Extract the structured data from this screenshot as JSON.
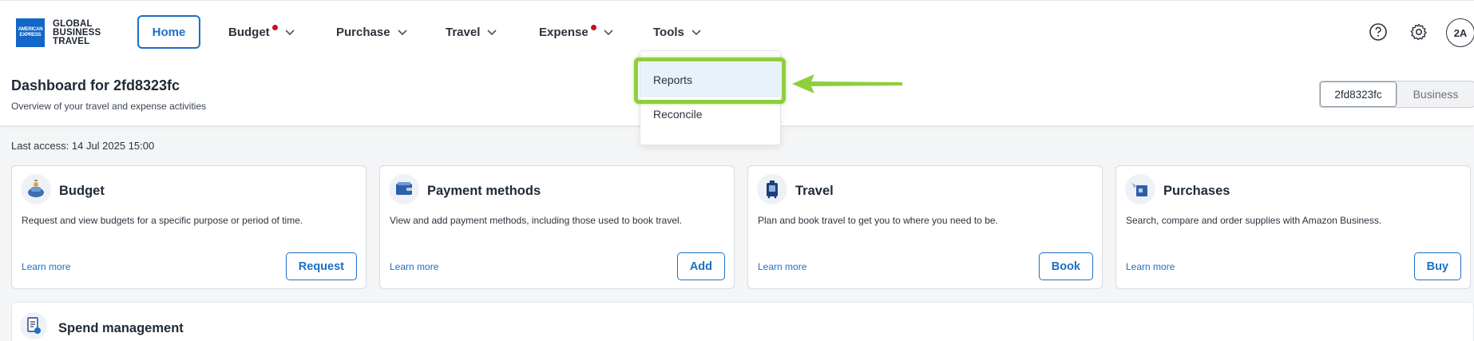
{
  "logo": {
    "box_text": "AMERICAN EXPRESS",
    "line1": "GLOBAL",
    "line2": "BUSINESS",
    "line3": "TRAVEL"
  },
  "nav": {
    "home": "Home",
    "budget": "Budget",
    "purchase": "Purchase",
    "travel": "Travel",
    "expense": "Expense",
    "tools": "Tools"
  },
  "user": {
    "initials": "2A"
  },
  "dashboard": {
    "title": "Dashboard for 2fd8323fc",
    "subtitle": "Overview of your travel and expense activities",
    "account_selected": "2fd8323fc",
    "account_other": "Business",
    "last_access": "Last access: 14 Jul 2025 15:00"
  },
  "tools_menu": {
    "reports": "Reports",
    "reconcile": "Reconcile"
  },
  "cards": [
    {
      "title": "Budget",
      "desc": "Request and view budgets for a specific purpose or period of time.",
      "link": "Learn more",
      "button": "Request"
    },
    {
      "title": "Payment methods",
      "desc": "View and add payment methods, including those used to book travel.",
      "link": "Learn more",
      "button": "Add"
    },
    {
      "title": "Travel",
      "desc": "Plan and book travel to get you to where you need to be.",
      "link": "Learn more",
      "button": "Book"
    },
    {
      "title": "Purchases",
      "desc": "Search, compare and order supplies with Amazon Business.",
      "link": "Learn more",
      "button": "Buy"
    }
  ],
  "spend": {
    "title": "Spend management"
  },
  "colors": {
    "brand_blue": "#1d6fc5",
    "notification_dot": "#c8101e",
    "highlight_green": "#8fce3f"
  }
}
